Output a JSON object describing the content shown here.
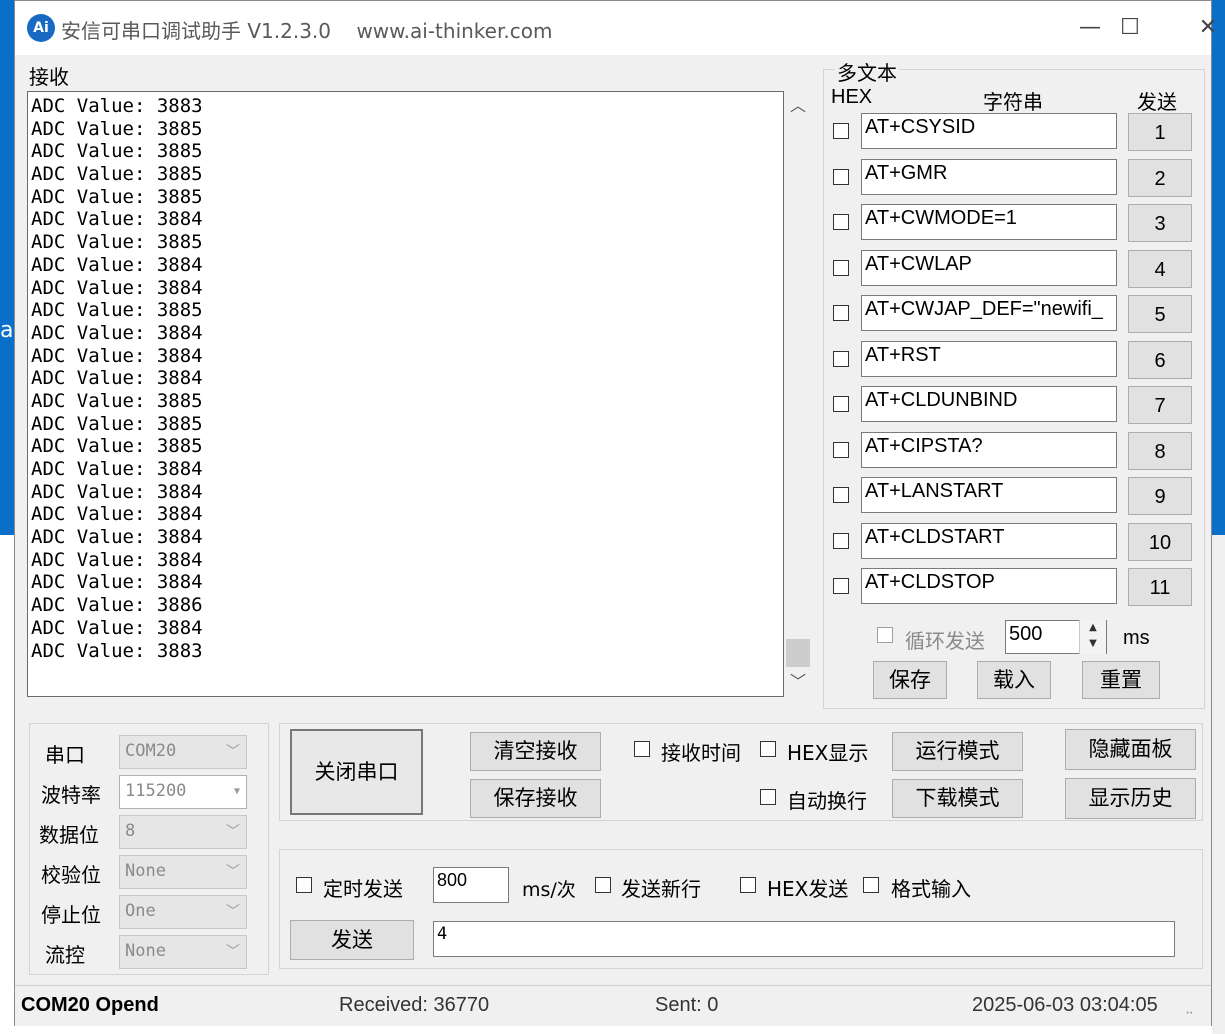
{
  "window": {
    "title": "安信可串口调试助手 V1.2.3.0    www.ai-thinker.com",
    "icon_text": "Ai",
    "minimize_glyph": "—",
    "maximize_glyph": "☐",
    "close_glyph": "✕"
  },
  "background": {
    "stray_text": "a"
  },
  "receive": {
    "label": "接收",
    "lines": [
      "ADC Value: 3883",
      "ADC Value: 3885",
      "ADC Value: 3885",
      "ADC Value: 3885",
      "ADC Value: 3885",
      "ADC Value: 3884",
      "ADC Value: 3885",
      "ADC Value: 3884",
      "ADC Value: 3884",
      "ADC Value: 3885",
      "ADC Value: 3884",
      "ADC Value: 3884",
      "ADC Value: 3884",
      "ADC Value: 3885",
      "ADC Value: 3885",
      "ADC Value: 3885",
      "ADC Value: 3884",
      "ADC Value: 3884",
      "ADC Value: 3884",
      "ADC Value: 3884",
      "ADC Value: 3884",
      "ADC Value: 3884",
      "ADC Value: 3886",
      "ADC Value: 3884",
      "ADC Value: 3883"
    ]
  },
  "multitext": {
    "label": "多文本",
    "header_hex": "HEX",
    "header_string": "字符串",
    "header_send": "发送",
    "rows": [
      {
        "text": "AT+CSYSID",
        "btn": "1"
      },
      {
        "text": "AT+GMR",
        "btn": "2"
      },
      {
        "text": "AT+CWMODE=1",
        "btn": "3"
      },
      {
        "text": "AT+CWLAP",
        "btn": "4"
      },
      {
        "text": "AT+CWJAP_DEF=\"newifi_",
        "btn": "5"
      },
      {
        "text": "AT+RST",
        "btn": "6"
      },
      {
        "text": "AT+CLDUNBIND",
        "btn": "7"
      },
      {
        "text": "AT+CIPSTA?",
        "btn": "8"
      },
      {
        "text": "AT+LANSTART",
        "btn": "9"
      },
      {
        "text": "AT+CLDSTART",
        "btn": "10"
      },
      {
        "text": "AT+CLDSTOP",
        "btn": "11"
      }
    ],
    "loop_send_label": "循环发送",
    "loop_interval": "500",
    "loop_unit": "ms",
    "save_label": "保存",
    "load_label": "载入",
    "reset_label": "重置"
  },
  "port_settings": {
    "port_label": "串口",
    "port_value": "COM20",
    "baud_label": "波特率",
    "baud_value": "115200",
    "databits_label": "数据位",
    "databits_value": "8",
    "parity_label": "校验位",
    "parity_value": "None",
    "stopbits_label": "停止位",
    "stopbits_value": "One",
    "flow_label": "流控",
    "flow_value": "None"
  },
  "controls": {
    "close_port": "关闭串口",
    "clear_receive": "清空接收",
    "save_receive": "保存接收",
    "receive_time": "接收时间",
    "hex_display": "HEX显示",
    "auto_newline": "自动换行",
    "run_mode": "运行模式",
    "download_mode": "下载模式",
    "hide_panel": "隐藏面板",
    "show_history": "显示历史"
  },
  "send": {
    "timed_send": "定时发送",
    "interval": "800",
    "interval_unit": "ms/次",
    "send_newline": "发送新行",
    "hex_send": "HEX发送",
    "format_input": "格式输入",
    "send_button": "发送",
    "send_text": "4"
  },
  "status": {
    "port": "COM20 Opend",
    "received": "Received: 36770",
    "sent": "Sent: 0",
    "datetime": "2025-06-03 03:04:05"
  }
}
